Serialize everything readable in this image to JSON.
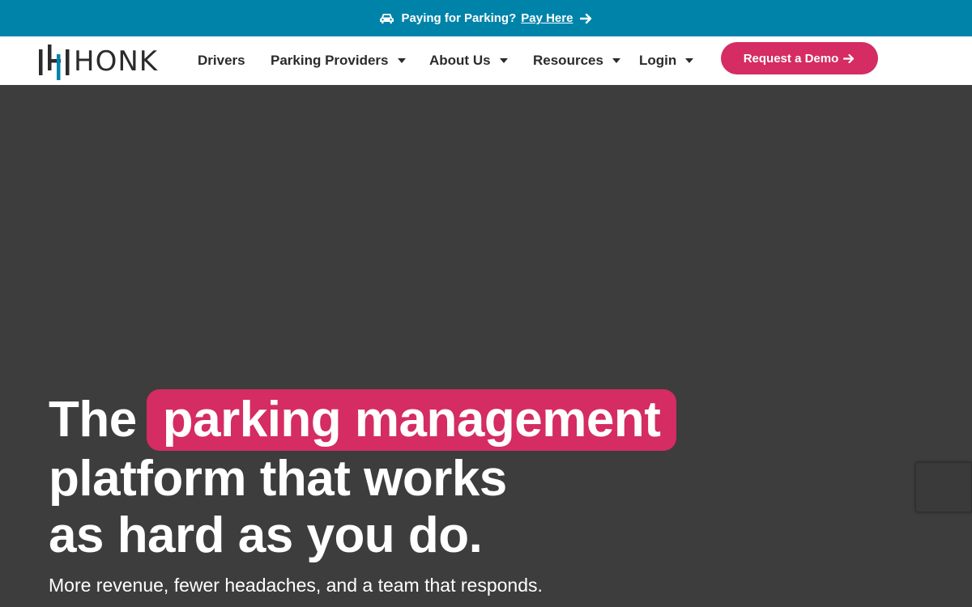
{
  "topbar": {
    "text": "Paying for Parking?",
    "link_label": "Pay Here",
    "icon": "car-icon",
    "arrow_icon": "arrow-right-icon",
    "background": "#0083a9"
  },
  "nav": {
    "logo_text": "HONK",
    "items": [
      {
        "label": "Drivers",
        "has_dropdown": false
      },
      {
        "label": "Parking Providers",
        "has_dropdown": true
      },
      {
        "label": "About Us",
        "has_dropdown": true
      },
      {
        "label": "Resources",
        "has_dropdown": true
      },
      {
        "label": "Login",
        "has_dropdown": true
      }
    ],
    "cta_label": "Request a Demo",
    "cta_color": "#d42c63"
  },
  "hero": {
    "headline_prefix": "The",
    "headline_highlight": "parking management",
    "headline_line2": "platform that works",
    "headline_line3": "as hard as you do.",
    "subhead": "More revenue, fewer headaches, and a team that responds.",
    "background": "#3d3d3d",
    "highlight_color": "#d42c63"
  },
  "colors": {
    "brand_teal": "#0083a9",
    "brand_pink": "#d42c63",
    "text_dark": "#2b2b2b"
  }
}
